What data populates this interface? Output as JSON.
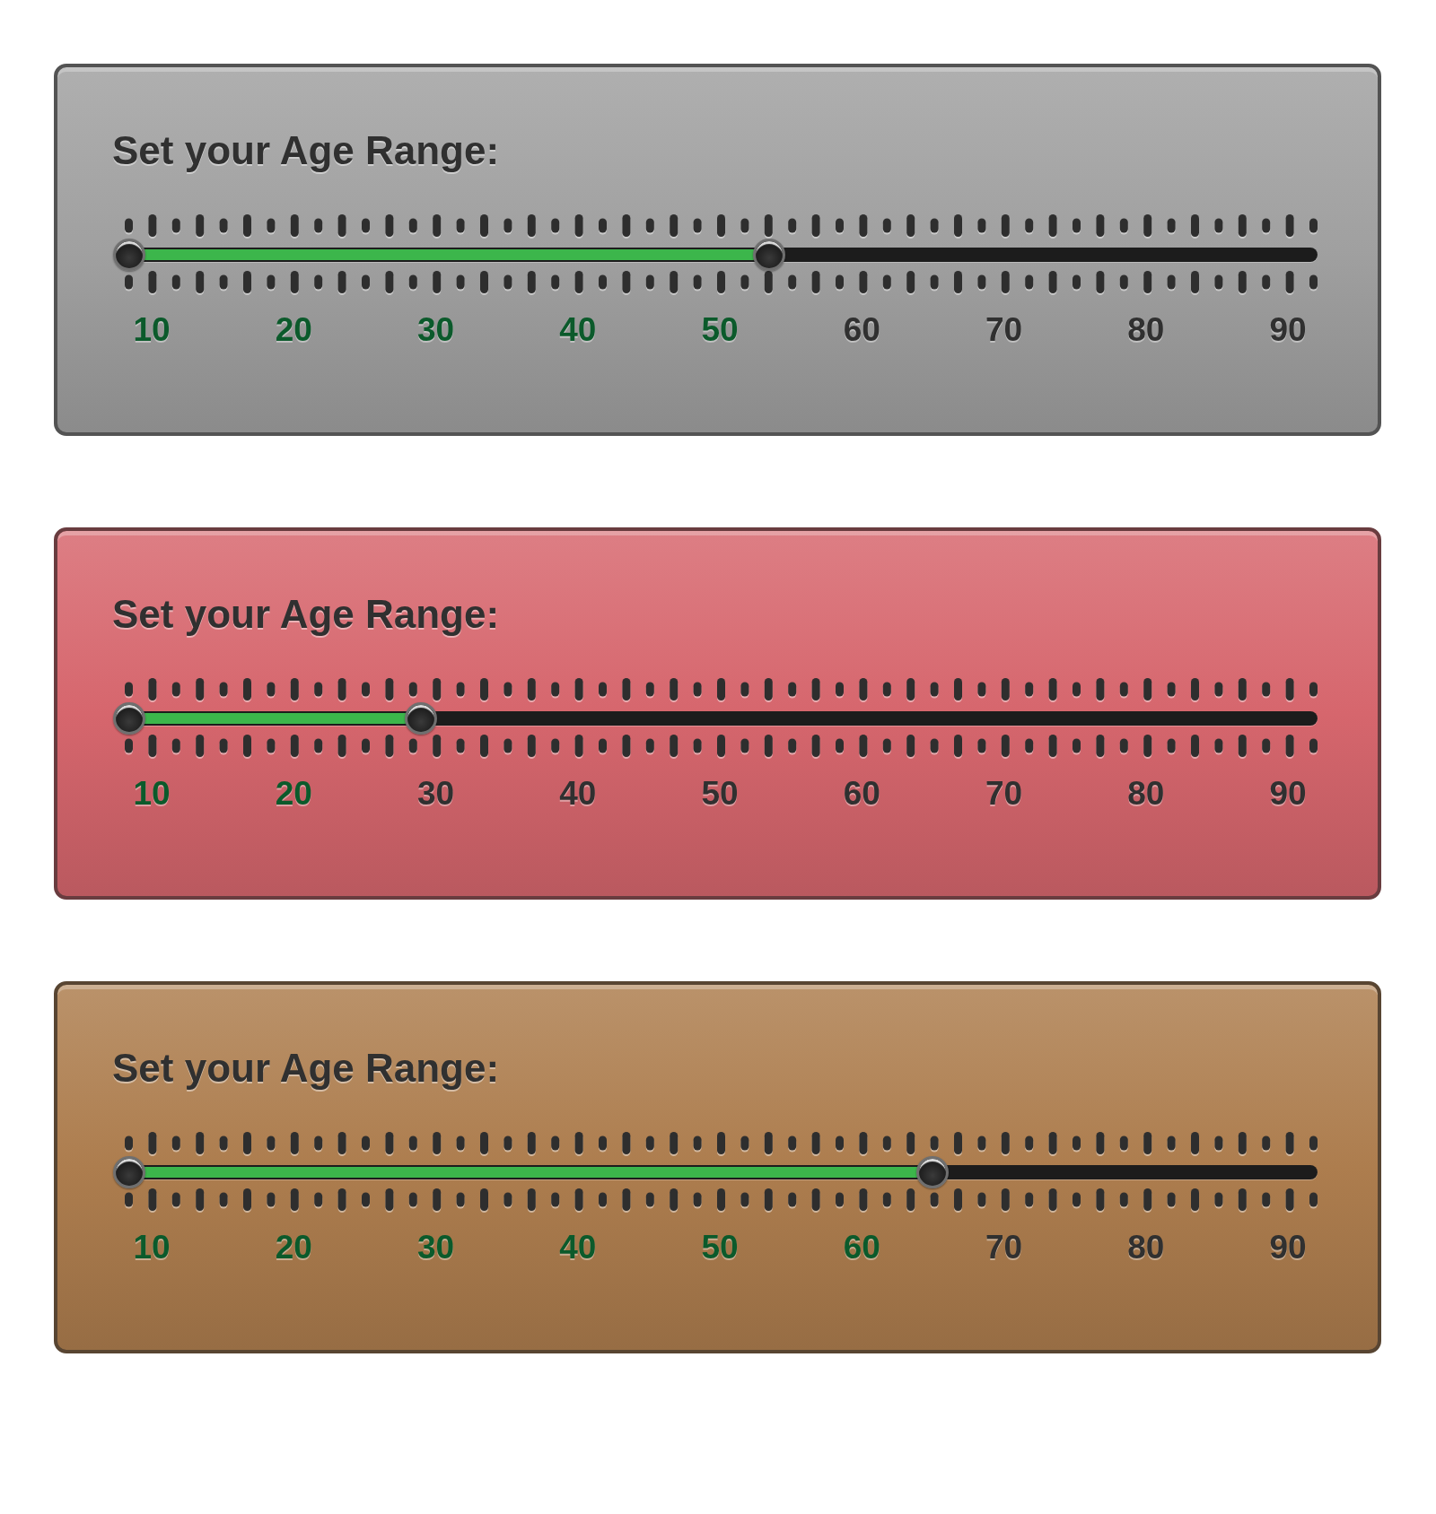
{
  "panels": [
    {
      "color": "#a0a0a0",
      "title": "Set your Age Range:",
      "slider": {
        "thumbs": [
          {
            "level": 0
          },
          {
            "level": 0.54
          }
        ]
      },
      "scale_labels": [
        {
          "text": "10",
          "in_range": true
        },
        {
          "text": "20",
          "in_range": true
        },
        {
          "text": "30",
          "in_range": true
        },
        {
          "text": "40",
          "in_range": true
        },
        {
          "text": "50",
          "in_range": true
        },
        {
          "text": "60",
          "in_range": false
        },
        {
          "text": "70",
          "in_range": false
        },
        {
          "text": "80",
          "in_range": false
        },
        {
          "text": "90",
          "in_range": false
        }
      ]
    },
    {
      "color": "#d6666d",
      "title": "Set your Age Range:",
      "slider": {
        "thumbs": [
          {
            "level": 0
          },
          {
            "level": 0.246
          }
        ]
      },
      "scale_labels": [
        {
          "text": "10",
          "in_range": true
        },
        {
          "text": "20",
          "in_range": true
        },
        {
          "text": "30",
          "in_range": false
        },
        {
          "text": "40",
          "in_range": false
        },
        {
          "text": "50",
          "in_range": false
        },
        {
          "text": "60",
          "in_range": false
        },
        {
          "text": "70",
          "in_range": false
        },
        {
          "text": "80",
          "in_range": false
        },
        {
          "text": "90",
          "in_range": false
        }
      ]
    },
    {
      "color": "#ad7d4e",
      "title": "Set your Age Range:",
      "slider": {
        "thumbs": [
          {
            "level": 0
          },
          {
            "level": 0.678
          }
        ]
      },
      "scale_labels": [
        {
          "text": "10",
          "in_range": true
        },
        {
          "text": "20",
          "in_range": true
        },
        {
          "text": "30",
          "in_range": true
        },
        {
          "text": "40",
          "in_range": true
        },
        {
          "text": "50",
          "in_range": true
        },
        {
          "text": "60",
          "in_range": true
        },
        {
          "text": "70",
          "in_range": false
        },
        {
          "text": "80",
          "in_range": false
        },
        {
          "text": "90",
          "in_range": false
        }
      ]
    }
  ]
}
